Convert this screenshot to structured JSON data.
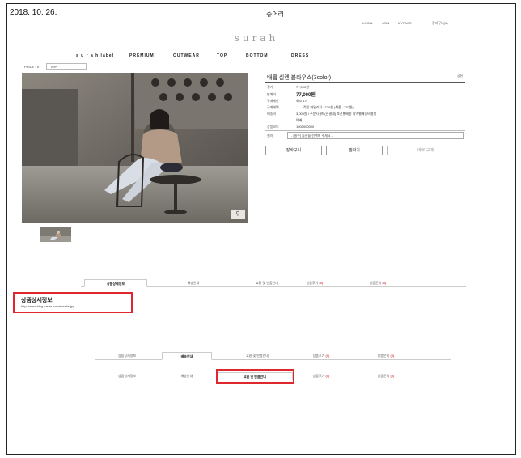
{
  "header": {
    "date": "2018. 10. 26.",
    "page_title": "슈어러",
    "util_links": [
      "LOGIN",
      "JOIN",
      "MYPAGE",
      "장바구니(0)"
    ],
    "logo": "surah"
  },
  "nav": {
    "items": [
      "s u r a h  label",
      "PREMIUM",
      "OUTWEAR",
      "TOP",
      "BOTTOM",
      "DRESS"
    ]
  },
  "breadcrumb": {
    "label": "PRICE : ∨",
    "select": "TOP"
  },
  "product": {
    "name": "배룸 실켄 블라우스(3color)",
    "share": "공유",
    "rows": [
      {
        "label": "정가",
        "value": "77,000원",
        "style": "strike"
      },
      {
        "label": "판매가",
        "value": "77,000원",
        "style": "price"
      },
      {
        "label": "구매제한",
        "value": "최소 1개",
        "style": ""
      },
      {
        "label": "구매혜택",
        "value": "적립 마일리지 : 770원 (최종 : 770원)",
        "style": ""
      },
      {
        "label": "배송비",
        "value": "3,000원 / 주문시결제(선결제)    조건별배송        지역별배송비설정",
        "style": ""
      },
      {
        "label": "",
        "value": "택배",
        "style": ""
      },
      {
        "label": "상품코드",
        "value": "1000000000",
        "style": ""
      }
    ],
    "option_label": "컬러",
    "option_placeholder": "- [필수] 옵션을 선택해 주세요 -",
    "buttons": {
      "cart": "장바구니",
      "wish": "찜하기",
      "buy": "바로 구매"
    },
    "zoom_icon": "magnifier-icon"
  },
  "tabs_top": [
    {
      "label": "상품상세정보",
      "count": "",
      "active": true
    },
    {
      "label": "배송안내",
      "count": "",
      "active": false
    },
    {
      "label": "교환 및 반품안내",
      "count": "",
      "active": false
    },
    {
      "label": "상품후기",
      "count": "(0)",
      "active": false
    },
    {
      "label": "상품문의",
      "count": "(0)",
      "active": false
    }
  ],
  "detail": {
    "title": "상품상세정보",
    "url": "http://www.blog.naver.com/surahs.jpg"
  },
  "tabs_mid": [
    {
      "label": "상품상세정보",
      "count": "",
      "active": false
    },
    {
      "label": "배송안내",
      "count": "",
      "active": true
    },
    {
      "label": "교환 및 반품안내",
      "count": "",
      "active": false
    },
    {
      "label": "상품후기",
      "count": "(0)",
      "active": false
    },
    {
      "label": "상품문의",
      "count": "(0)",
      "active": false
    }
  ],
  "tabs_bot": [
    {
      "label": "상품상세정보",
      "count": "",
      "active": false
    },
    {
      "label": "배송안내",
      "count": "",
      "active": false
    },
    {
      "label": "교환 및 반품안내",
      "count": "",
      "active": true
    },
    {
      "label": "상품후기",
      "count": "(0)",
      "active": false
    },
    {
      "label": "상품문의",
      "count": "(0)",
      "active": false
    }
  ],
  "colors": {
    "highlight_box": "#e0262f",
    "count_red": "#cc0000"
  }
}
